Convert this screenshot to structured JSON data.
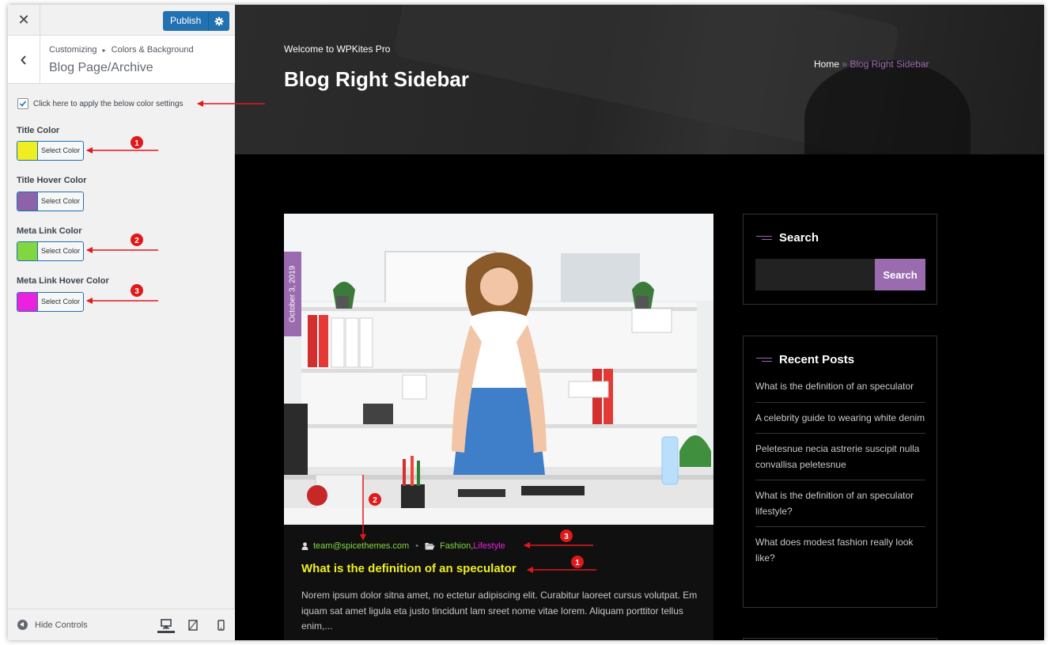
{
  "customizer": {
    "close_label": "✕",
    "publish_label": "Publish",
    "breadcrumb_root": "Customizing",
    "breadcrumb_separator": "▸",
    "breadcrumb_parent": "Colors & Background",
    "section_title": "Blog Page/Archive",
    "apply_label": "Click here to apply the below color settings",
    "apply_checked": true,
    "controls": [
      {
        "label": "Title Color",
        "button": "Select Color",
        "color": "#eeee22"
      },
      {
        "label": "Title Hover Color",
        "button": "Select Color",
        "color": "#8e62a9"
      },
      {
        "label": "Meta Link Color",
        "button": "Select Color",
        "color": "#81d742"
      },
      {
        "label": "Meta Link Hover Color",
        "button": "Select Color",
        "color": "#ea22dd"
      }
    ],
    "footer": {
      "hide_controls": "Hide Controls"
    }
  },
  "preview": {
    "hero": {
      "welcome": "Welcome to WPKites Pro",
      "title": "Blog Right Sidebar",
      "breadcrumb_home": "Home",
      "breadcrumb_sep": "»",
      "breadcrumb_current": "Blog Right Sidebar"
    },
    "post": {
      "date": "October 3, 2019",
      "author": "team@spicethemes.com",
      "category_1": "Fashion",
      "category_sep": ",",
      "category_2": "Lifestyle",
      "title": "What is the definition of an speculator",
      "excerpt": "Norem ipsum dolor sitna amet, no ectetur adipiscing elit. Curabitur laoreet cursus volutpat. Em iquam sat amet ligula eta justo tincidunt lam sreet nome vitae lorem. Aliquam porttitor tellus enim,..."
    },
    "sidebar": {
      "search_title": "Search",
      "search_button": "Search",
      "recent_title": "Recent Posts",
      "recent_posts": [
        "What is the definition of an speculator",
        "A celebrity guide to wearing white denim",
        "Peletesnue necia astrerie suscipit nulla convallisa peletesnue",
        "What is the definition of an speculator lifestyle?",
        "What does modest fashion really look like?"
      ]
    }
  },
  "annotations": {
    "badge_1": "1",
    "badge_2": "2",
    "badge_3": "3"
  },
  "colors": {
    "accent": "#9b6bb0",
    "publish": "#2271b1",
    "annotation": "#e0191a"
  }
}
